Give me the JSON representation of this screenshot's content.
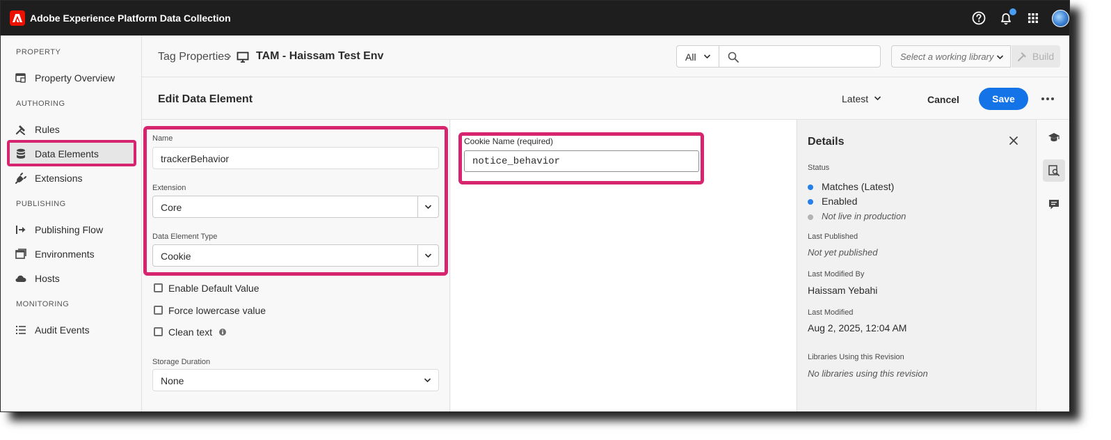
{
  "app": {
    "title": "Adobe Experience Platform Data Collection"
  },
  "topbar_icons": [
    "help-icon",
    "bell-icon",
    "apps-grid-icon",
    "avatar"
  ],
  "sidebar": {
    "sections": [
      {
        "label": "PROPERTY"
      },
      {
        "label": "AUTHORING"
      },
      {
        "label": "PUBLISHING"
      },
      {
        "label": "MONITORING"
      }
    ],
    "items": [
      {
        "label": "Property Overview",
        "icon": "property-overview-icon"
      },
      {
        "label": "Rules",
        "icon": "rules-icon"
      },
      {
        "label": "Data Elements",
        "icon": "database-icon",
        "selected": true
      },
      {
        "label": "Extensions",
        "icon": "plug-icon"
      },
      {
        "label": "Publishing Flow",
        "icon": "publishing-flow-icon"
      },
      {
        "label": "Environments",
        "icon": "environments-icon"
      },
      {
        "label": "Hosts",
        "icon": "cloud-icon"
      },
      {
        "label": "Audit Events",
        "icon": "list-icon"
      }
    ]
  },
  "header": {
    "breadcrumb_root": "Tag Properties",
    "breadcrumb_current": "TAM - Haissam Test Env",
    "search_scope": "All",
    "search_placeholder": "",
    "library_placeholder": "Select a working library",
    "build_label": "Build"
  },
  "edit": {
    "title": "Edit Data Element",
    "revision": "Latest",
    "cancel_label": "Cancel",
    "save_label": "Save"
  },
  "form": {
    "name_label": "Name",
    "name_value": "trackerBehavior",
    "extension_label": "Extension",
    "extension_value": "Core",
    "type_label": "Data Element Type",
    "type_value": "Cookie",
    "checkboxes": [
      {
        "label": "Enable Default Value",
        "checked": false
      },
      {
        "label": "Force lowercase value",
        "checked": false
      },
      {
        "label": "Clean text",
        "checked": false
      }
    ],
    "storage_label": "Storage Duration",
    "storage_value": "None"
  },
  "settings": {
    "cookie_label": "Cookie Name (required)",
    "cookie_value": "notice_behavior"
  },
  "details": {
    "title": "Details",
    "status_label": "Status",
    "status_items": [
      {
        "label": "Matches (Latest)",
        "color": "#2680eb"
      },
      {
        "label": "Enabled",
        "color": "#2680eb"
      },
      {
        "label": "Not live in production",
        "color": "#b3b3b3"
      }
    ],
    "last_published_label": "Last Published",
    "last_published_value": "Not yet published",
    "last_modified_by_label": "Last Modified By",
    "last_modified_by_value": "Haissam Yebahi",
    "last_modified_label": "Last Modified",
    "last_modified_value": "Aug 2, 2025, 12:04 AM",
    "libraries_label": "Libraries Using this Revision",
    "libraries_value": "No libraries using this revision"
  },
  "colors": {
    "highlight": "#d6246e",
    "accent": "#1473e6",
    "adobe_red": "#eb1000"
  }
}
